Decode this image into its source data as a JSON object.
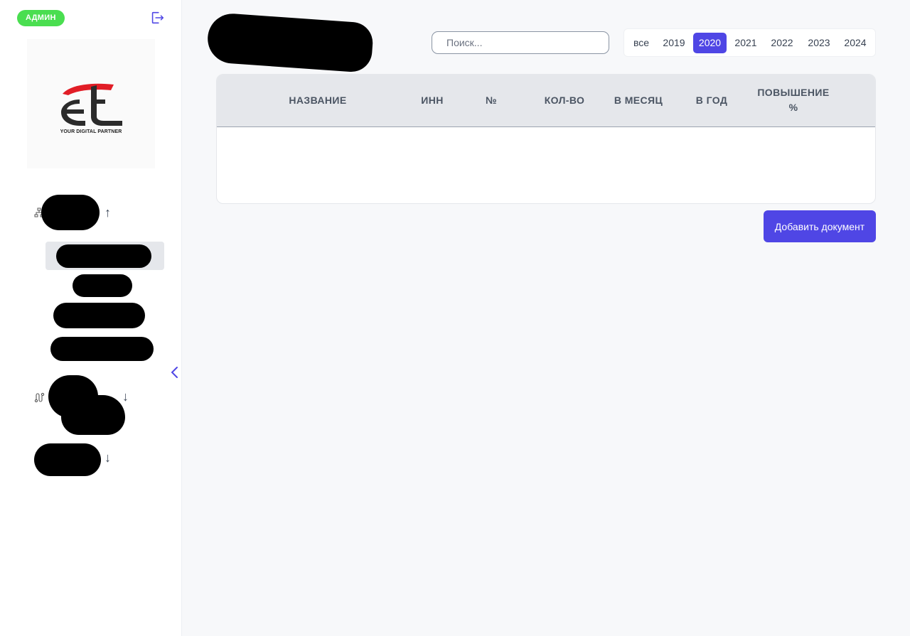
{
  "sidebar": {
    "admin_badge": "АДМИН",
    "logo_tagline": "YOUR DIGITAL PARTNER",
    "nav_arrows": {
      "up": "↑",
      "down": "↓"
    }
  },
  "search": {
    "placeholder": "Поиск..."
  },
  "year_filter": {
    "options": [
      "все",
      "2019",
      "2020",
      "2021",
      "2022",
      "2023",
      "2024"
    ],
    "selected": "2020"
  },
  "table": {
    "headers": [
      "НАЗВАНИЕ",
      "ИНН",
      "№",
      "КОЛ-ВО",
      "В МЕСЯЦ",
      "В ГОД",
      "ПОВЫШЕНИЕ %"
    ],
    "rows": []
  },
  "add_button": "Добавить документ",
  "colors": {
    "accent": "#4f46e5",
    "admin_badge": "#4ade50",
    "logo_red": "#e11d26",
    "logo_dark": "#2b2b2b"
  },
  "icons": [
    "logout-icon",
    "sitemap-icon",
    "route-icon",
    "chevron-left-icon",
    "arrow-up-icon",
    "arrow-down-icon"
  ]
}
